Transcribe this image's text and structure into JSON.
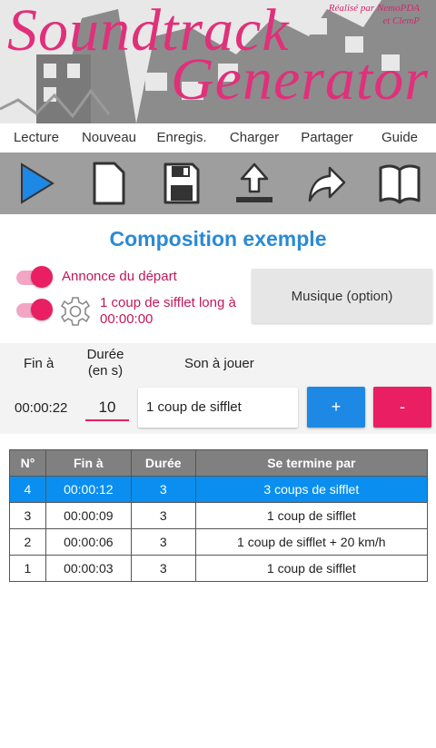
{
  "header": {
    "title_line1": "Soundtrack",
    "title_line2": "Generator",
    "credit_line1": "Réalisé par NemoPDA",
    "credit_line2": "et ClemP"
  },
  "menu": [
    "Lecture",
    "Nouveau",
    "Enregis.",
    "Charger",
    "Partager",
    "Guide"
  ],
  "toolbar_icons": [
    "play-icon",
    "new-file-icon",
    "save-icon",
    "upload-icon",
    "share-icon",
    "book-icon"
  ],
  "composition": {
    "title": "Composition exemple",
    "announce_label": "Annonce du départ",
    "announce_on": true,
    "sifflet_label": "1 coup de sifflet long à 00:00:00",
    "sifflet_on": true,
    "music_button": "Musique (option)"
  },
  "entry": {
    "fin_header": "Fin à",
    "duree_header": "Durée (en s)",
    "son_header": "Son à jouer",
    "fin_value": "00:00:22",
    "duree_value": "10",
    "son_value": "1 coup de sifflet",
    "plus_label": "+",
    "minus_label": "-"
  },
  "table": {
    "headers": [
      "N°",
      "Fin à",
      "Durée",
      "Se termine par"
    ],
    "rows": [
      {
        "n": "4",
        "fin": "00:00:12",
        "duree": "3",
        "termine": "3 coups de sifflet",
        "selected": true
      },
      {
        "n": "3",
        "fin": "00:00:09",
        "duree": "3",
        "termine": "1 coup de sifflet",
        "selected": false
      },
      {
        "n": "2",
        "fin": "00:00:06",
        "duree": "3",
        "termine": "1 coup de sifflet + 20 km/h",
        "selected": false
      },
      {
        "n": "1",
        "fin": "00:00:03",
        "duree": "3",
        "termine": "1 coup de sifflet",
        "selected": false
      }
    ]
  },
  "colors": {
    "accent_pink": "#e91e63",
    "accent_blue": "#1e88e5",
    "title_blue": "#2a8ad6",
    "selected_row": "#0a8ff0"
  }
}
